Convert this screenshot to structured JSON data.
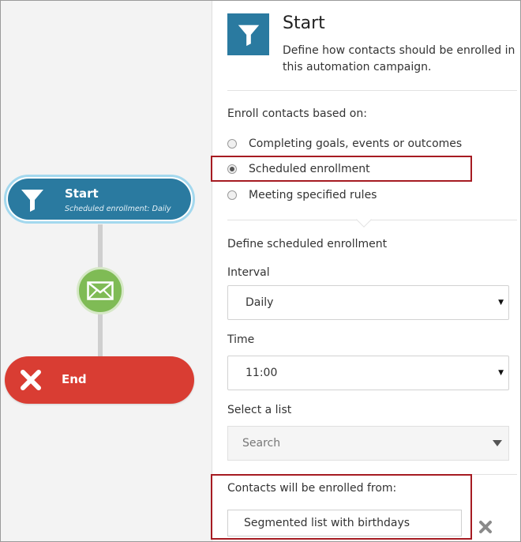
{
  "canvas": {
    "start_node": {
      "title": "Start",
      "subtitle": "Scheduled enrollment: Daily",
      "icon": "funnel-icon"
    },
    "email_node": {
      "icon": "envelope-icon"
    },
    "end_node": {
      "title": "End",
      "icon": "close-icon"
    }
  },
  "panel": {
    "icon": "funnel-icon",
    "title": "Start",
    "description": "Define how contacts should be enrolled in this automation campaign.",
    "enroll_label": "Enroll contacts based on:",
    "enroll_options": [
      {
        "label": "Completing goals, events or outcomes",
        "checked": false
      },
      {
        "label": "Scheduled enrollment",
        "checked": true
      },
      {
        "label": "Meeting specified rules",
        "checked": false
      }
    ],
    "schedule_heading": "Define scheduled enrollment",
    "interval": {
      "label": "Interval",
      "value": "Daily"
    },
    "time": {
      "label": "Time",
      "value": "11:00"
    },
    "list": {
      "label": "Select a list",
      "placeholder": "Search"
    },
    "enrolled_from": {
      "label": "Contacts will be enrolled from:",
      "value": "Segmented list with birthdays"
    }
  },
  "colors": {
    "start_node": "#2a7aa0",
    "start_node_ring": "#a3d8ee",
    "email_node": "#7fbb55",
    "end_node": "#d93d33",
    "highlight": "#a61b22",
    "canvas_bg": "#f3f3f3"
  }
}
